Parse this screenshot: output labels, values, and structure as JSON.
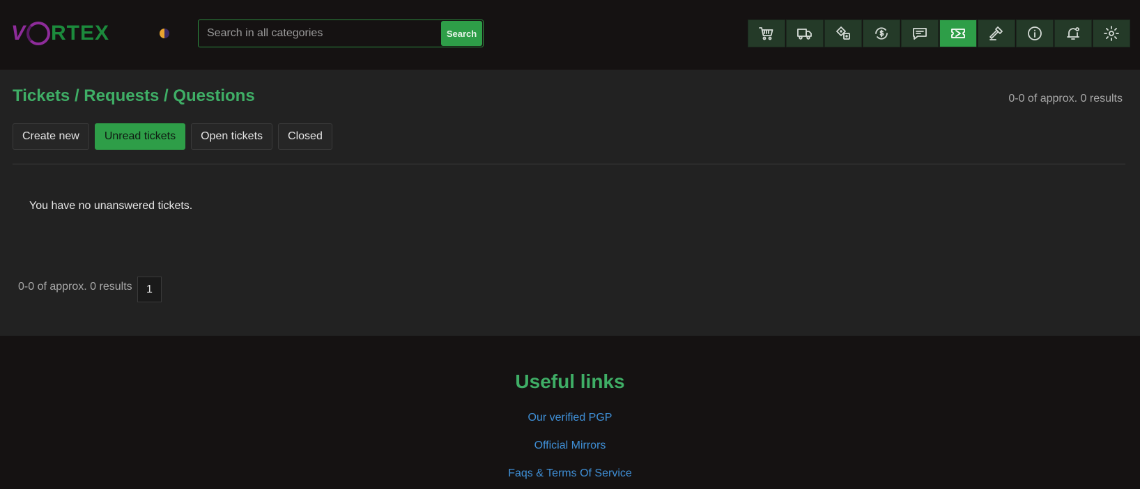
{
  "header": {
    "logo": {
      "v": "V",
      "rest": "RTEX"
    },
    "search": {
      "placeholder": "Search in all categories",
      "value": "",
      "button_label": "Search"
    },
    "icons": [
      {
        "name": "cart-icon",
        "active": false
      },
      {
        "name": "truck-icon",
        "active": false
      },
      {
        "name": "dice-icon",
        "active": false
      },
      {
        "name": "currency-exchange-icon",
        "active": false
      },
      {
        "name": "chat-icon",
        "active": false
      },
      {
        "name": "ticket-icon",
        "active": true
      },
      {
        "name": "gavel-icon",
        "active": false
      },
      {
        "name": "info-icon",
        "active": false
      },
      {
        "name": "bell-icon",
        "active": false
      },
      {
        "name": "gear-icon",
        "active": false
      }
    ]
  },
  "main": {
    "title": "Tickets / Requests / Questions",
    "results_top": "0-0 of approx. 0 results",
    "tabs": [
      {
        "label": "Create new",
        "active": false
      },
      {
        "label": "Unread tickets",
        "active": true
      },
      {
        "label": "Open tickets",
        "active": false
      },
      {
        "label": "Closed",
        "active": false
      }
    ],
    "empty_message": "You have no unanswered tickets.",
    "results_bottom": "0-0 of approx. 0 results",
    "page": "1"
  },
  "footer": {
    "title": "Useful links",
    "links": [
      "Our verified PGP",
      "Official Mirrors",
      "Faqs & Terms Of Service"
    ]
  },
  "colors": {
    "accent": "#2e9e48",
    "title_green": "#3fae66",
    "link_blue": "#3f8fd6",
    "logo_purple": "#8e2c9a"
  }
}
